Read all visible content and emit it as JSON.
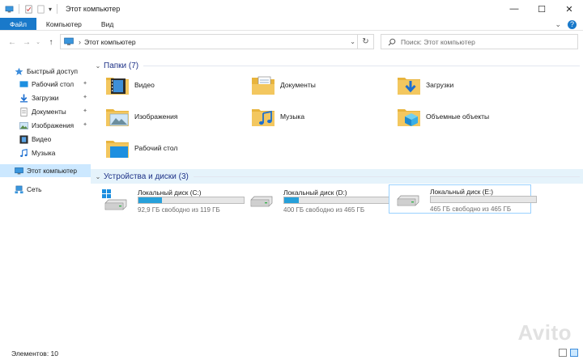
{
  "window": {
    "title": "Этот компьютер",
    "controls": {
      "minimize": "—",
      "maximize": "☐",
      "close": "✕"
    }
  },
  "ribbon": {
    "tabs": [
      "Файл",
      "Компьютер",
      "Вид"
    ],
    "expand_icon": "⌄",
    "help_icon": "?"
  },
  "navigation": {
    "back": "←",
    "forward": "→",
    "recent": "⌄",
    "up": "↑",
    "path_separator": "›",
    "path": "Этот компьютер",
    "dropdown": "⌄",
    "refresh": "↻"
  },
  "search": {
    "placeholder": "Поиск: Этот компьютер",
    "icon": "search-icon"
  },
  "sidebar": {
    "items": [
      {
        "label": "Быстрый доступ",
        "icon": "star-icon"
      },
      {
        "label": "Рабочий стол",
        "icon": "desktop-icon",
        "pinned": true
      },
      {
        "label": "Загрузки",
        "icon": "download-icon",
        "pinned": true
      },
      {
        "label": "Документы",
        "icon": "documents-icon",
        "pinned": true
      },
      {
        "label": "Изображения",
        "icon": "pictures-icon",
        "pinned": true
      },
      {
        "label": "Видео",
        "icon": "video-icon"
      },
      {
        "label": "Музыка",
        "icon": "music-icon"
      },
      {
        "label": "Этот компьютер",
        "icon": "computer-icon",
        "selected": true
      },
      {
        "label": "Сеть",
        "icon": "network-icon"
      }
    ],
    "pin_glyph": "📌"
  },
  "folders_section": {
    "title": "Папки (7)",
    "chevron": "⌄",
    "items": [
      {
        "label": "Видео",
        "icon": "video-folder-icon"
      },
      {
        "label": "Документы",
        "icon": "documents-folder-icon"
      },
      {
        "label": "Загрузки",
        "icon": "downloads-folder-icon"
      },
      {
        "label": "Изображения",
        "icon": "pictures-folder-icon"
      },
      {
        "label": "Музыка",
        "icon": "music-folder-icon"
      },
      {
        "label": "Объемные объекты",
        "icon": "3d-objects-folder-icon"
      },
      {
        "label": "Рабочий стол",
        "icon": "desktop-folder-icon"
      }
    ]
  },
  "drives_section": {
    "title": "Устройства и диски (3)",
    "chevron": "⌄",
    "items": [
      {
        "name": "Локальный диск (C:)",
        "free": "92,9 ГБ свободно из 119 ГБ",
        "used_fraction": 0.22,
        "system": true
      },
      {
        "name": "Локальный диск (D:)",
        "free": "400 ГБ свободно из 465 ГБ",
        "used_fraction": 0.14,
        "system": false
      },
      {
        "name": "Локальный диск (E:)",
        "free": "465 ГБ свободно из 465 ГБ",
        "used_fraction": 0.0,
        "system": false,
        "selected": true
      }
    ]
  },
  "status": {
    "count": "Элементов: 10"
  },
  "colors": {
    "accent": "#1979ca",
    "selection": "#cce8ff",
    "progress": "#26a0da",
    "folder": "#f3c75f"
  }
}
